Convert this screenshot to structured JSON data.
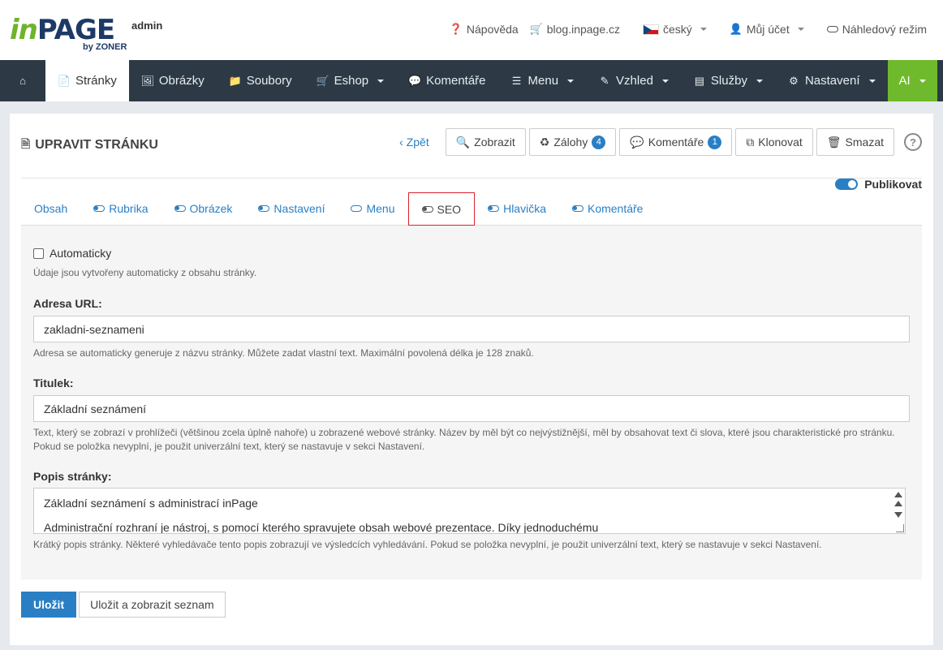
{
  "header": {
    "logo_in": "in",
    "logo_page": "PAGE",
    "logo_by": "by ZONER",
    "logo_admin": "admin",
    "links": {
      "help": "Nápověda",
      "blog": "blog.inpage.cz",
      "language": "český",
      "account": "Můj účet",
      "preview": "Náhledový režim"
    }
  },
  "nav": {
    "items": [
      {
        "label": "",
        "icon": "home-icon"
      },
      {
        "label": "Stránky",
        "icon": "file-icon"
      },
      {
        "label": "Obrázky",
        "icon": "image-icon"
      },
      {
        "label": "Soubory",
        "icon": "folder-icon"
      },
      {
        "label": "Eshop",
        "icon": "cart-icon"
      },
      {
        "label": "Komentáře",
        "icon": "comments-icon"
      },
      {
        "label": "Menu",
        "icon": "list-icon"
      },
      {
        "label": "Vzhled",
        "icon": "brush-icon"
      },
      {
        "label": "Služby",
        "icon": "services-icon"
      },
      {
        "label": "Nastavení",
        "icon": "gear-icon"
      },
      {
        "label": "AI",
        "icon": ""
      },
      {
        "label": "+",
        "icon": "plus-icon"
      }
    ]
  },
  "page": {
    "title": "UPRAVIT STRÁNKU",
    "back": "Zpět",
    "actions": {
      "view": "Zobrazit",
      "backups": "Zálohy",
      "backups_count": "4",
      "comments": "Komentáře",
      "comments_count": "1",
      "clone": "Klonovat",
      "delete": "Smazat"
    },
    "publish_label": "Publikovat"
  },
  "tabs": [
    "Obsah",
    "Rubrika",
    "Obrázek",
    "Nastavení",
    "Menu",
    "SEO",
    "Hlavička",
    "Komentáře"
  ],
  "seo": {
    "auto_label": "Automaticky",
    "auto_help": "Údaje jsou vytvořeny automaticky z obsahu stránky.",
    "url_label": "Adresa URL:",
    "url_value": "zakladni-seznameni",
    "url_help": "Adresa se automaticky generuje z názvu stránky. Můžete zadat vlastní text. Maximální povolená délka je 128 znaků.",
    "title_label": "Titulek:",
    "title_value": "Základní seznámení",
    "title_help_1": "Text, který se zobrazí v prohlížeči (většinou zcela úplně nahoře) u zobrazené webové stránky. Název by měl být co nejvýstižnější, měl by obsahovat text či slova, které jsou charakteristické pro stránku.",
    "title_help_2": "Pokud se položka nevyplní, je použit univerzální text, který se nastavuje v sekci Nastavení.",
    "desc_label": "Popis stránky:",
    "desc_line_1": "Základní seznámení s administrací inPage",
    "desc_line_2": "Administrační rozhraní je nástroj, s pomocí kterého spravujete obsah webové prezentace. Díky jednoduchému",
    "desc_help": "Krátký popis stránky. Některé vyhledávače tento popis zobrazují ve výsledcích vyhledávání. Pokud se položka nevyplní, je použit univerzální text, který se nastavuje v sekci Nastavení."
  },
  "footer": {
    "save": "Uložit",
    "save_list": "Uložit a zobrazit seznam"
  },
  "colors": {
    "brand_green": "#6fb42c",
    "brand_blue": "#1d3a66",
    "nav_bg": "#2d3a46",
    "accent": "#2a7fc4",
    "active_tab_border": "#d9232d"
  }
}
